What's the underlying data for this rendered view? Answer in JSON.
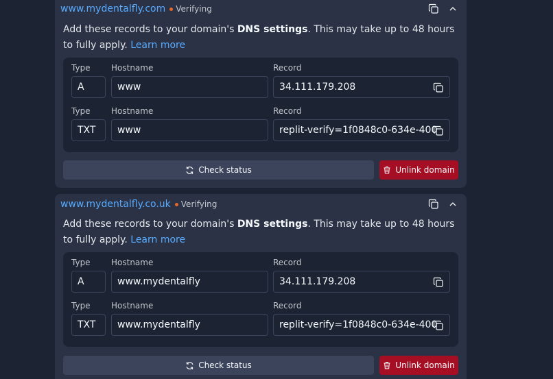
{
  "domains": [
    {
      "name": "www.mydentalfly.com",
      "status": "Verifying",
      "description_before": "Add these records to your domain's ",
      "description_bold": "DNS settings",
      "description_after": ". This may take up to 48 hours to fully apply. ",
      "learn_more": "Learn more",
      "records": [
        {
          "type_label": "Type",
          "hostname_label": "Hostname",
          "record_label": "Record",
          "type": "A",
          "hostname": "www",
          "record": "34.111.179.208"
        },
        {
          "type_label": "Type",
          "hostname_label": "Hostname",
          "record_label": "Record",
          "type": "TXT",
          "hostname": "www",
          "record": "replit-verify=1f0848c0-634e-400"
        }
      ],
      "check_status": "Check status",
      "unlink": "Unlink domain"
    },
    {
      "name": "www.mydentalfly.co.uk",
      "status": "Verifying",
      "description_before": "Add these records to your domain's ",
      "description_bold": "DNS settings",
      "description_after": ". This may take up to 48 hours to fully apply. ",
      "learn_more": "Learn more",
      "records": [
        {
          "type_label": "Type",
          "hostname_label": "Hostname",
          "record_label": "Record",
          "type": "A",
          "hostname": "www.mydentalfly",
          "record": "34.111.179.208"
        },
        {
          "type_label": "Type",
          "hostname_label": "Hostname",
          "record_label": "Record",
          "type": "TXT",
          "hostname": "www.mydentalfly",
          "record": "replit-verify=1f0848c0-634e-400"
        }
      ],
      "check_status": "Check status",
      "unlink": "Unlink domain"
    }
  ],
  "icons": {
    "copy": "copy-icon",
    "collapse": "chevron-up-icon",
    "refresh": "refresh-icon",
    "trash": "trash-icon"
  },
  "colors": {
    "background": "#1c2333",
    "card": "#2b3245",
    "link": "#57abff",
    "status_dot": "#e56a2b",
    "danger": "#a60e24"
  }
}
